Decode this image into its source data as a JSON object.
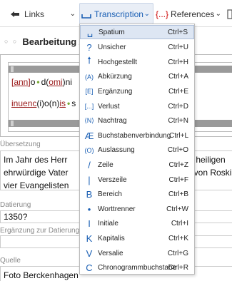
{
  "toolbar": {
    "links_label": "Links",
    "transcription_label": "Transcription",
    "references_prefix": "{...}",
    "references_label": "References",
    "chevron": "⌄"
  },
  "panel": {
    "title": "Bearbeitung A"
  },
  "editor": {
    "line1": [
      {
        "t": "[ann]",
        "u": true
      },
      {
        "t": "o",
        "u": false
      },
      {
        "t": "•",
        "dot": true
      },
      {
        "t": "d(",
        "u": false
      },
      {
        "t": "omi",
        "u": true
      },
      {
        "t": ")ni",
        "u": false
      }
    ],
    "line2": [
      {
        "t": "inuenc",
        "u": true
      },
      {
        "t": "(i)o(n)",
        "u": false
      },
      {
        "t": "is",
        "u": true
      },
      {
        "t": "•",
        "dot": true
      },
      {
        "t": "s",
        "u": false
      }
    ]
  },
  "fields": {
    "uebersetzung_label": "Übersetzung",
    "uebersetzung_l1a": "Im Jahr des Herr",
    "uebersetzung_l1b": "s heiligen K",
    "uebersetzung_l2a": "ehrwürdige Vater",
    "uebersetzung_l2b": "f von Roski",
    "uebersetzung_l3": "vier Evangelisten",
    "datierung_label": "Datierung",
    "datierung_value": "1350?",
    "ergaenzung_label": "Ergänzung zur Datierung",
    "quelle_label": "Quelle",
    "quelle_value": "Foto Berckenhagen"
  },
  "menu": {
    "items": [
      {
        "label": "Spatium",
        "shortcut": "Ctrl+S",
        "icon": "spatium-icon",
        "glyph": "␣",
        "selected": true
      },
      {
        "label": "Unsicher",
        "shortcut": "Ctrl+U",
        "icon": "question-icon",
        "glyph": "?"
      },
      {
        "label": "Hochgestellt",
        "shortcut": "Ctrl+H",
        "icon": "arrow-up-icon",
        "glyph": "🠕"
      },
      {
        "label": "Abkürzung",
        "shortcut": "Ctrl+A",
        "icon": "abbreviation-icon",
        "glyph": "(A)"
      },
      {
        "label": "Ergänzung",
        "shortcut": "Ctrl+E",
        "icon": "bracket-e-icon",
        "glyph": "[E]"
      },
      {
        "label": "Verlust",
        "shortcut": "Ctrl+D",
        "icon": "bracket-ellipsis-icon",
        "glyph": "[...]"
      },
      {
        "label": "Nachtrag",
        "shortcut": "Ctrl+N",
        "icon": "nachtrag-icon",
        "glyph": "⟨N⟩"
      },
      {
        "label": "Buchstabenverbindung",
        "shortcut": "Ctrl+L",
        "icon": "ligature-icon",
        "glyph": "Æ"
      },
      {
        "label": "Auslassung",
        "shortcut": "Ctrl+O",
        "icon": "omission-icon",
        "glyph": "(O)"
      },
      {
        "label": "Zeile",
        "shortcut": "Ctrl+Z",
        "icon": "slash-icon",
        "glyph": "/"
      },
      {
        "label": "Verszeile",
        "shortcut": "Ctrl+F",
        "icon": "bar-icon",
        "glyph": "|"
      },
      {
        "label": "Bereich",
        "shortcut": "Ctrl+B",
        "icon": "b-icon",
        "glyph": "B"
      },
      {
        "label": "Worttrenner",
        "shortcut": "Ctrl+W",
        "icon": "dot-icon",
        "glyph": "•"
      },
      {
        "label": "Initiale",
        "shortcut": "Ctrl+I",
        "icon": "i-icon",
        "glyph": "I"
      },
      {
        "label": "Kapitalis",
        "shortcut": "Ctrl+K",
        "icon": "k-icon",
        "glyph": "K"
      },
      {
        "label": "Versalie",
        "shortcut": "Ctrl+G",
        "icon": "v-icon",
        "glyph": "V"
      },
      {
        "label": "Chronogrammbuchstabe",
        "shortcut": "Ctrl+R",
        "icon": "c-icon",
        "glyph": "C"
      }
    ]
  },
  "colors": {
    "accent": "#1a5fb4",
    "selected_bg": "#dde6f3",
    "abbrev_red": "#9a1a1a"
  }
}
